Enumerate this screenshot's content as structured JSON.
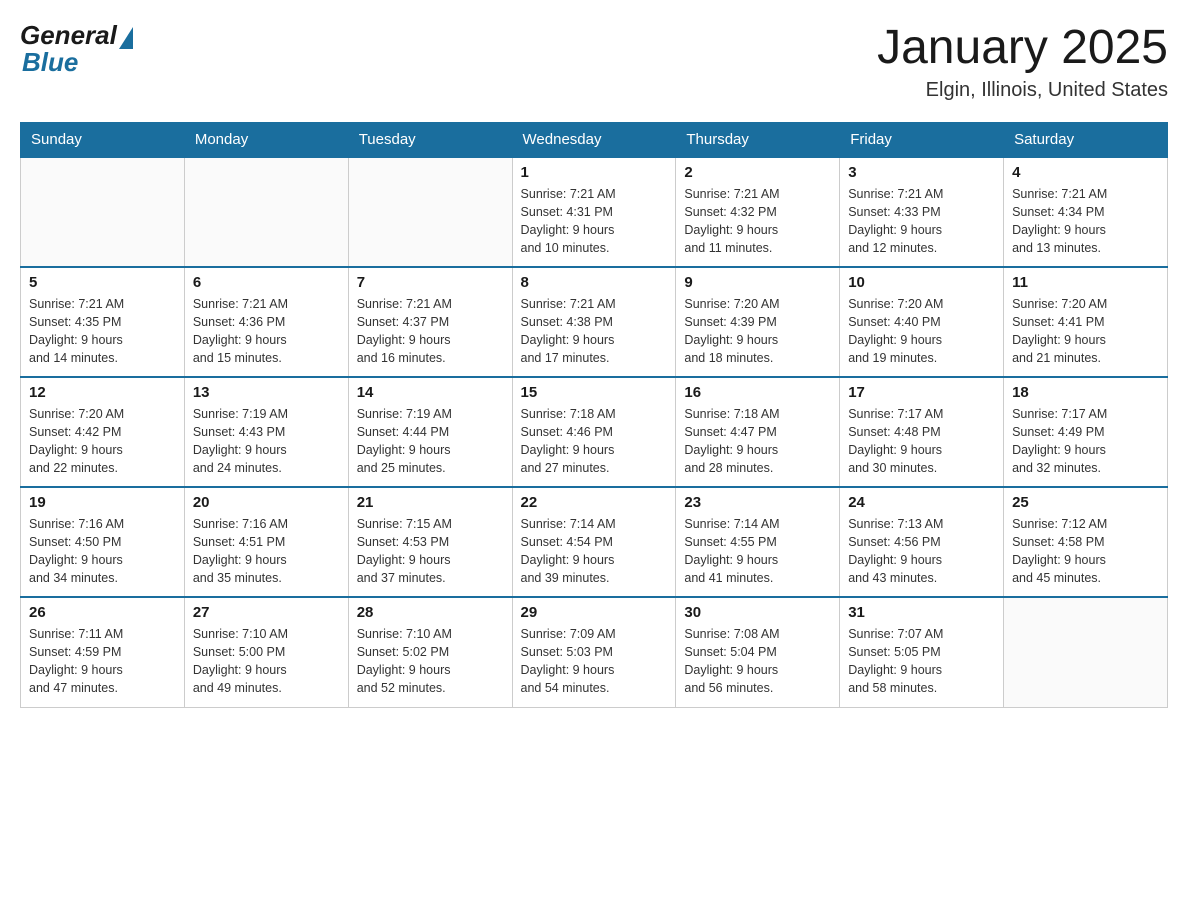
{
  "header": {
    "logo_general": "General",
    "logo_blue": "Blue",
    "month_title": "January 2025",
    "location": "Elgin, Illinois, United States"
  },
  "days_of_week": [
    "Sunday",
    "Monday",
    "Tuesday",
    "Wednesday",
    "Thursday",
    "Friday",
    "Saturday"
  ],
  "weeks": [
    [
      {
        "day": "",
        "info": ""
      },
      {
        "day": "",
        "info": ""
      },
      {
        "day": "",
        "info": ""
      },
      {
        "day": "1",
        "info": "Sunrise: 7:21 AM\nSunset: 4:31 PM\nDaylight: 9 hours\nand 10 minutes."
      },
      {
        "day": "2",
        "info": "Sunrise: 7:21 AM\nSunset: 4:32 PM\nDaylight: 9 hours\nand 11 minutes."
      },
      {
        "day": "3",
        "info": "Sunrise: 7:21 AM\nSunset: 4:33 PM\nDaylight: 9 hours\nand 12 minutes."
      },
      {
        "day": "4",
        "info": "Sunrise: 7:21 AM\nSunset: 4:34 PM\nDaylight: 9 hours\nand 13 minutes."
      }
    ],
    [
      {
        "day": "5",
        "info": "Sunrise: 7:21 AM\nSunset: 4:35 PM\nDaylight: 9 hours\nand 14 minutes."
      },
      {
        "day": "6",
        "info": "Sunrise: 7:21 AM\nSunset: 4:36 PM\nDaylight: 9 hours\nand 15 minutes."
      },
      {
        "day": "7",
        "info": "Sunrise: 7:21 AM\nSunset: 4:37 PM\nDaylight: 9 hours\nand 16 minutes."
      },
      {
        "day": "8",
        "info": "Sunrise: 7:21 AM\nSunset: 4:38 PM\nDaylight: 9 hours\nand 17 minutes."
      },
      {
        "day": "9",
        "info": "Sunrise: 7:20 AM\nSunset: 4:39 PM\nDaylight: 9 hours\nand 18 minutes."
      },
      {
        "day": "10",
        "info": "Sunrise: 7:20 AM\nSunset: 4:40 PM\nDaylight: 9 hours\nand 19 minutes."
      },
      {
        "day": "11",
        "info": "Sunrise: 7:20 AM\nSunset: 4:41 PM\nDaylight: 9 hours\nand 21 minutes."
      }
    ],
    [
      {
        "day": "12",
        "info": "Sunrise: 7:20 AM\nSunset: 4:42 PM\nDaylight: 9 hours\nand 22 minutes."
      },
      {
        "day": "13",
        "info": "Sunrise: 7:19 AM\nSunset: 4:43 PM\nDaylight: 9 hours\nand 24 minutes."
      },
      {
        "day": "14",
        "info": "Sunrise: 7:19 AM\nSunset: 4:44 PM\nDaylight: 9 hours\nand 25 minutes."
      },
      {
        "day": "15",
        "info": "Sunrise: 7:18 AM\nSunset: 4:46 PM\nDaylight: 9 hours\nand 27 minutes."
      },
      {
        "day": "16",
        "info": "Sunrise: 7:18 AM\nSunset: 4:47 PM\nDaylight: 9 hours\nand 28 minutes."
      },
      {
        "day": "17",
        "info": "Sunrise: 7:17 AM\nSunset: 4:48 PM\nDaylight: 9 hours\nand 30 minutes."
      },
      {
        "day": "18",
        "info": "Sunrise: 7:17 AM\nSunset: 4:49 PM\nDaylight: 9 hours\nand 32 minutes."
      }
    ],
    [
      {
        "day": "19",
        "info": "Sunrise: 7:16 AM\nSunset: 4:50 PM\nDaylight: 9 hours\nand 34 minutes."
      },
      {
        "day": "20",
        "info": "Sunrise: 7:16 AM\nSunset: 4:51 PM\nDaylight: 9 hours\nand 35 minutes."
      },
      {
        "day": "21",
        "info": "Sunrise: 7:15 AM\nSunset: 4:53 PM\nDaylight: 9 hours\nand 37 minutes."
      },
      {
        "day": "22",
        "info": "Sunrise: 7:14 AM\nSunset: 4:54 PM\nDaylight: 9 hours\nand 39 minutes."
      },
      {
        "day": "23",
        "info": "Sunrise: 7:14 AM\nSunset: 4:55 PM\nDaylight: 9 hours\nand 41 minutes."
      },
      {
        "day": "24",
        "info": "Sunrise: 7:13 AM\nSunset: 4:56 PM\nDaylight: 9 hours\nand 43 minutes."
      },
      {
        "day": "25",
        "info": "Sunrise: 7:12 AM\nSunset: 4:58 PM\nDaylight: 9 hours\nand 45 minutes."
      }
    ],
    [
      {
        "day": "26",
        "info": "Sunrise: 7:11 AM\nSunset: 4:59 PM\nDaylight: 9 hours\nand 47 minutes."
      },
      {
        "day": "27",
        "info": "Sunrise: 7:10 AM\nSunset: 5:00 PM\nDaylight: 9 hours\nand 49 minutes."
      },
      {
        "day": "28",
        "info": "Sunrise: 7:10 AM\nSunset: 5:02 PM\nDaylight: 9 hours\nand 52 minutes."
      },
      {
        "day": "29",
        "info": "Sunrise: 7:09 AM\nSunset: 5:03 PM\nDaylight: 9 hours\nand 54 minutes."
      },
      {
        "day": "30",
        "info": "Sunrise: 7:08 AM\nSunset: 5:04 PM\nDaylight: 9 hours\nand 56 minutes."
      },
      {
        "day": "31",
        "info": "Sunrise: 7:07 AM\nSunset: 5:05 PM\nDaylight: 9 hours\nand 58 minutes."
      },
      {
        "day": "",
        "info": ""
      }
    ]
  ]
}
